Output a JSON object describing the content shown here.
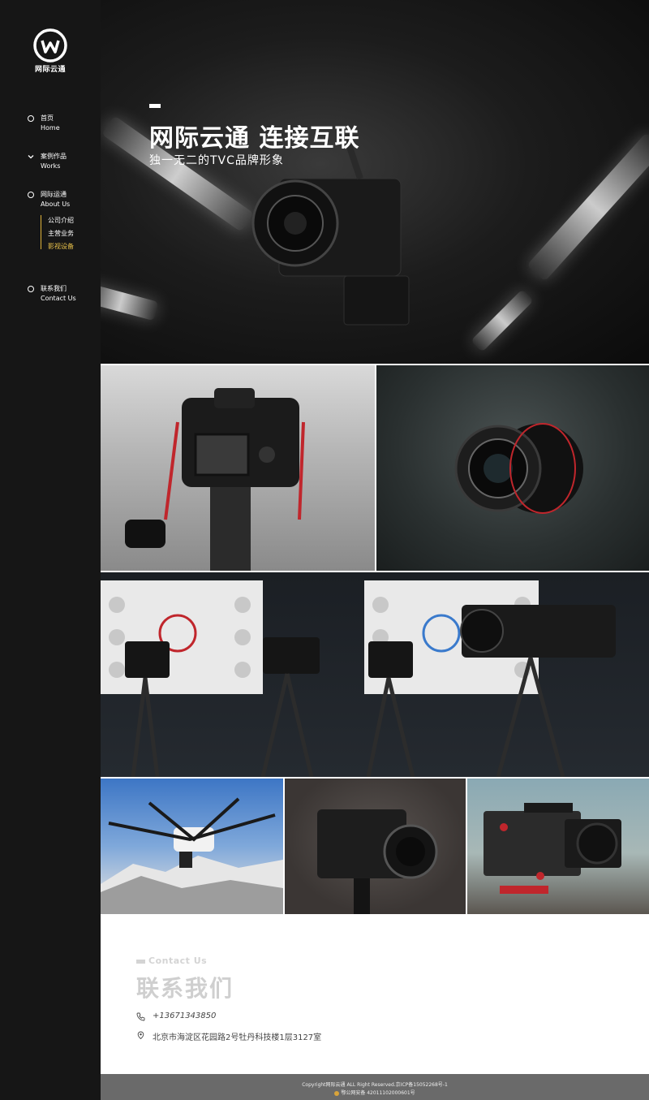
{
  "brand": {
    "name": "网际云通"
  },
  "nav": [
    {
      "cn": "首页",
      "en": "Home",
      "icon": "circle-icon"
    },
    {
      "cn": "案例作品",
      "en": "Works",
      "icon": "chevron-down-icon"
    },
    {
      "cn": "网际运通",
      "en": "About Us",
      "icon": "circle-icon"
    },
    {
      "cn": "联系我们",
      "en": "Contact Us",
      "icon": "circle-icon"
    }
  ],
  "subnav": [
    {
      "label": "公司介绍",
      "active": false
    },
    {
      "label": "主营业务",
      "active": false
    },
    {
      "label": "影视设备",
      "active": true
    }
  ],
  "hero": {
    "title": "网际云通  连接互联",
    "subtitle": "独一无二的TVC品牌形象"
  },
  "gallery": [
    "dslr-camera-on-tripod-photo",
    "canon-lens-photo",
    "cinema-cameras-test-chart-photo",
    "drone-photo",
    "vintage-camera-photo",
    "cinema-rig-photo"
  ],
  "contact": {
    "title_en": "Contact Us",
    "title_cn": "联系我们",
    "phone": "+13671343850",
    "address": "北京市海淀区花园路2号牡丹科技楼1层3127室"
  },
  "footer": {
    "copyright": "Copyright网际云通 ALL Right Reserved.京ICP备15052268号-1",
    "police": "鄂公网安备 42011102000601号"
  },
  "colors": {
    "sidebar": "#161616",
    "accent": "#e8c14a",
    "footer": "#6a6a6a"
  }
}
